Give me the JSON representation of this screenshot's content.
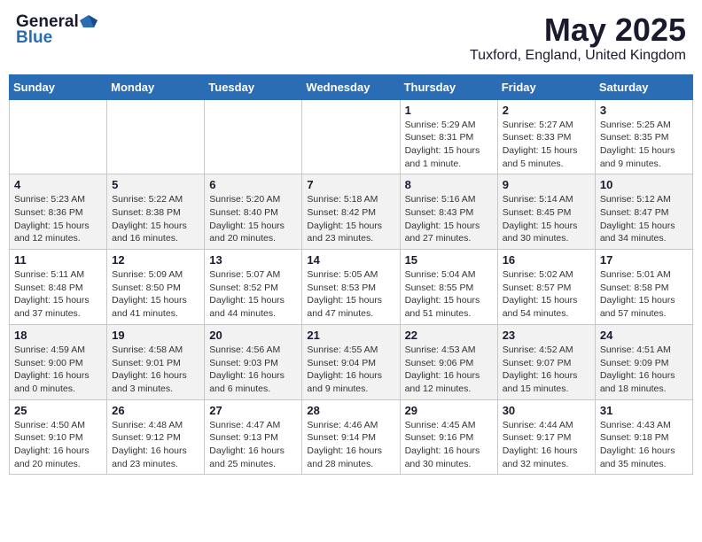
{
  "header": {
    "logo_general": "General",
    "logo_blue": "Blue",
    "month": "May 2025",
    "location": "Tuxford, England, United Kingdom"
  },
  "days_of_week": [
    "Sunday",
    "Monday",
    "Tuesday",
    "Wednesday",
    "Thursday",
    "Friday",
    "Saturday"
  ],
  "weeks": [
    [
      {
        "day": "",
        "info": ""
      },
      {
        "day": "",
        "info": ""
      },
      {
        "day": "",
        "info": ""
      },
      {
        "day": "",
        "info": ""
      },
      {
        "day": "1",
        "info": "Sunrise: 5:29 AM\nSunset: 8:31 PM\nDaylight: 15 hours\nand 1 minute."
      },
      {
        "day": "2",
        "info": "Sunrise: 5:27 AM\nSunset: 8:33 PM\nDaylight: 15 hours\nand 5 minutes."
      },
      {
        "day": "3",
        "info": "Sunrise: 5:25 AM\nSunset: 8:35 PM\nDaylight: 15 hours\nand 9 minutes."
      }
    ],
    [
      {
        "day": "4",
        "info": "Sunrise: 5:23 AM\nSunset: 8:36 PM\nDaylight: 15 hours\nand 12 minutes."
      },
      {
        "day": "5",
        "info": "Sunrise: 5:22 AM\nSunset: 8:38 PM\nDaylight: 15 hours\nand 16 minutes."
      },
      {
        "day": "6",
        "info": "Sunrise: 5:20 AM\nSunset: 8:40 PM\nDaylight: 15 hours\nand 20 minutes."
      },
      {
        "day": "7",
        "info": "Sunrise: 5:18 AM\nSunset: 8:42 PM\nDaylight: 15 hours\nand 23 minutes."
      },
      {
        "day": "8",
        "info": "Sunrise: 5:16 AM\nSunset: 8:43 PM\nDaylight: 15 hours\nand 27 minutes."
      },
      {
        "day": "9",
        "info": "Sunrise: 5:14 AM\nSunset: 8:45 PM\nDaylight: 15 hours\nand 30 minutes."
      },
      {
        "day": "10",
        "info": "Sunrise: 5:12 AM\nSunset: 8:47 PM\nDaylight: 15 hours\nand 34 minutes."
      }
    ],
    [
      {
        "day": "11",
        "info": "Sunrise: 5:11 AM\nSunset: 8:48 PM\nDaylight: 15 hours\nand 37 minutes."
      },
      {
        "day": "12",
        "info": "Sunrise: 5:09 AM\nSunset: 8:50 PM\nDaylight: 15 hours\nand 41 minutes."
      },
      {
        "day": "13",
        "info": "Sunrise: 5:07 AM\nSunset: 8:52 PM\nDaylight: 15 hours\nand 44 minutes."
      },
      {
        "day": "14",
        "info": "Sunrise: 5:05 AM\nSunset: 8:53 PM\nDaylight: 15 hours\nand 47 minutes."
      },
      {
        "day": "15",
        "info": "Sunrise: 5:04 AM\nSunset: 8:55 PM\nDaylight: 15 hours\nand 51 minutes."
      },
      {
        "day": "16",
        "info": "Sunrise: 5:02 AM\nSunset: 8:57 PM\nDaylight: 15 hours\nand 54 minutes."
      },
      {
        "day": "17",
        "info": "Sunrise: 5:01 AM\nSunset: 8:58 PM\nDaylight: 15 hours\nand 57 minutes."
      }
    ],
    [
      {
        "day": "18",
        "info": "Sunrise: 4:59 AM\nSunset: 9:00 PM\nDaylight: 16 hours\nand 0 minutes."
      },
      {
        "day": "19",
        "info": "Sunrise: 4:58 AM\nSunset: 9:01 PM\nDaylight: 16 hours\nand 3 minutes."
      },
      {
        "day": "20",
        "info": "Sunrise: 4:56 AM\nSunset: 9:03 PM\nDaylight: 16 hours\nand 6 minutes."
      },
      {
        "day": "21",
        "info": "Sunrise: 4:55 AM\nSunset: 9:04 PM\nDaylight: 16 hours\nand 9 minutes."
      },
      {
        "day": "22",
        "info": "Sunrise: 4:53 AM\nSunset: 9:06 PM\nDaylight: 16 hours\nand 12 minutes."
      },
      {
        "day": "23",
        "info": "Sunrise: 4:52 AM\nSunset: 9:07 PM\nDaylight: 16 hours\nand 15 minutes."
      },
      {
        "day": "24",
        "info": "Sunrise: 4:51 AM\nSunset: 9:09 PM\nDaylight: 16 hours\nand 18 minutes."
      }
    ],
    [
      {
        "day": "25",
        "info": "Sunrise: 4:50 AM\nSunset: 9:10 PM\nDaylight: 16 hours\nand 20 minutes."
      },
      {
        "day": "26",
        "info": "Sunrise: 4:48 AM\nSunset: 9:12 PM\nDaylight: 16 hours\nand 23 minutes."
      },
      {
        "day": "27",
        "info": "Sunrise: 4:47 AM\nSunset: 9:13 PM\nDaylight: 16 hours\nand 25 minutes."
      },
      {
        "day": "28",
        "info": "Sunrise: 4:46 AM\nSunset: 9:14 PM\nDaylight: 16 hours\nand 28 minutes."
      },
      {
        "day": "29",
        "info": "Sunrise: 4:45 AM\nSunset: 9:16 PM\nDaylight: 16 hours\nand 30 minutes."
      },
      {
        "day": "30",
        "info": "Sunrise: 4:44 AM\nSunset: 9:17 PM\nDaylight: 16 hours\nand 32 minutes."
      },
      {
        "day": "31",
        "info": "Sunrise: 4:43 AM\nSunset: 9:18 PM\nDaylight: 16 hours\nand 35 minutes."
      }
    ]
  ]
}
